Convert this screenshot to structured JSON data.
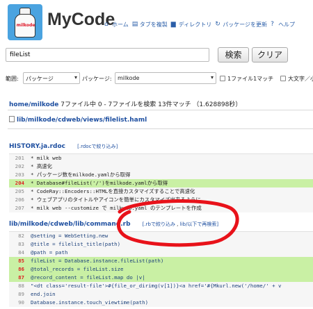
{
  "app": {
    "title": "MyCode",
    "logo_text": "milkode"
  },
  "nav": [
    {
      "icon": "home-icon",
      "glyph": "⌂",
      "label": "ホーム"
    },
    {
      "icon": "copy-tab-icon",
      "glyph": "▤",
      "label": "タブを複製"
    },
    {
      "icon": "directory-icon",
      "glyph": "▆",
      "label": "ディレクトリ"
    },
    {
      "icon": "refresh-icon",
      "glyph": "↻",
      "label": "パッケージを更新"
    },
    {
      "icon": "help-icon",
      "glyph": "?",
      "label": "ヘルプ"
    }
  ],
  "search": {
    "value": "fileList",
    "search_label": "検索",
    "clear_label": "クリア"
  },
  "filters": {
    "scope_label": "範囲:",
    "scope_value": "パッケージ",
    "package_label": "パッケージ:",
    "package_value": "milkode",
    "one_file_label": "1ファイル1マッチ",
    "case_label": "大文字／小"
  },
  "summary": {
    "path": "home/milkode",
    "text": " 7ファイル中 0 - 7ファイルを検索 13件マッチ （1.628898秒）"
  },
  "file_line": "lib/milkode/cdweb/views/filelist.haml",
  "results": [
    {
      "title": "HISTORY.ja.rdoc",
      "narrow_label": "[.rdocで絞り込み]",
      "lines": [
        {
          "num": "201",
          "text": "* milk web",
          "hl": false,
          "red": false
        },
        {
          "num": "202",
          "text": "  * 高速化",
          "hl": false,
          "red": false
        },
        {
          "num": "203",
          "text": "    * パッケージ数をmilkode.yamlから取得",
          "hl": false,
          "red": false
        },
        {
          "num": "204",
          "text": "    * Database#fileList('/')をmilkode.yamlから取得",
          "hl": true,
          "red": true
        },
        {
          "num": "205",
          "text": "    * CodeRay::Encoders::HTMLを直接カスタマイズすることで高速化",
          "hl": false,
          "red": false
        },
        {
          "num": "206",
          "text": "  * ウェブアプリのタイトルやアイコンを簡単にカスタマイズ出来るように",
          "hl": false,
          "red": false
        },
        {
          "num": "207",
          "text": "    * milk web --customize で milkweb.yaml のテンプレートを作成",
          "hl": false,
          "red": false
        }
      ]
    },
    {
      "title": "lib/milkode/cdweb/lib/command.rb",
      "narrow_label": "[.rbで絞り込み",
      "research_label": "lib/以下で再検索]",
      "lines": [
        {
          "num": "82",
          "text": "@setting = WebSetting.new",
          "hl": false,
          "red": false
        },
        {
          "num": "83",
          "text": "@title = filelist_title(path)",
          "hl": false,
          "red": false
        },
        {
          "num": "84",
          "text": "@path = path",
          "hl": false,
          "red": false
        },
        {
          "num": "85",
          "text": "fileList = Database.instance.fileList(path)",
          "hl": true,
          "red": true
        },
        {
          "num": "86",
          "text": "@total_records = fileList.size",
          "hl": true,
          "red": true
        },
        {
          "num": "87",
          "text": "@record_content = fileList.map do |v|",
          "hl": true,
          "red": true
        },
        {
          "num": "88",
          "text": "  \"<dt class='result-file'>#{file_or_dirimg(v[1])}<a href='#{Mkurl.new('/home/' + v",
          "hl": false,
          "red": false
        },
        {
          "num": "89",
          "text": "end.join",
          "hl": false,
          "red": false
        },
        {
          "num": "90",
          "text": "Database.instance.touch_viewtime(path)",
          "hl": false,
          "red": false
        }
      ]
    }
  ],
  "colors": {
    "link": "#1e4fa0",
    "highlight": "#c9f0a4",
    "annotation": "#e8121a",
    "logo_bg": "#4aa3e0"
  }
}
